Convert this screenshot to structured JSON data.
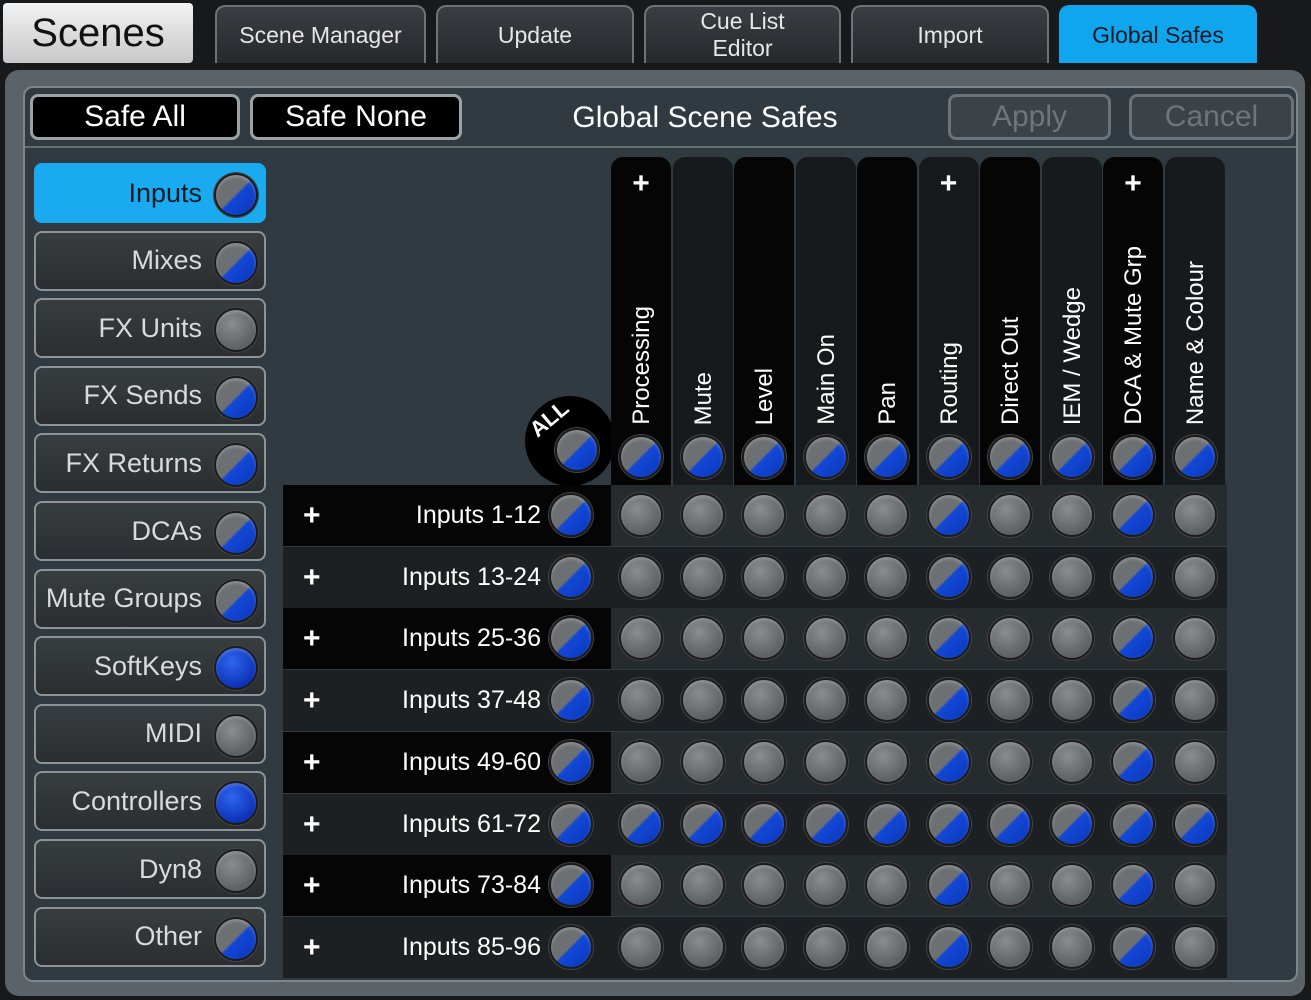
{
  "app_title": "Scenes",
  "tabs": [
    {
      "label": "Scene Manager",
      "active": false
    },
    {
      "label": "Update",
      "active": false
    },
    {
      "label": "Cue List Editor",
      "active": false
    },
    {
      "label": "Import",
      "active": false
    },
    {
      "label": "Global Safes",
      "active": true
    }
  ],
  "header": {
    "safe_all": "Safe All",
    "safe_none": "Safe None",
    "title": "Global Scene Safes",
    "apply": "Apply",
    "cancel": "Cancel"
  },
  "sidebar": [
    {
      "label": "Inputs",
      "state": "half",
      "active": true
    },
    {
      "label": "Mixes",
      "state": "half",
      "active": false
    },
    {
      "label": "FX Units",
      "state": "off",
      "active": false
    },
    {
      "label": "FX Sends",
      "state": "half",
      "active": false
    },
    {
      "label": "FX Returns",
      "state": "half",
      "active": false
    },
    {
      "label": "DCAs",
      "state": "half",
      "active": false
    },
    {
      "label": "Mute Groups",
      "state": "half",
      "active": false
    },
    {
      "label": "SoftKeys",
      "state": "on",
      "active": false
    },
    {
      "label": "MIDI",
      "state": "off",
      "active": false
    },
    {
      "label": "Controllers",
      "state": "on",
      "active": false
    },
    {
      "label": "Dyn8",
      "state": "off",
      "active": false
    },
    {
      "label": "Other",
      "state": "half",
      "active": false
    }
  ],
  "grid": {
    "all_label": "ALL",
    "all_state": "half",
    "columns": [
      {
        "label": "Processing",
        "expandable": true,
        "state": "half"
      },
      {
        "label": "Mute",
        "expandable": false,
        "state": "half"
      },
      {
        "label": "Level",
        "expandable": false,
        "state": "half"
      },
      {
        "label": "Main On",
        "expandable": false,
        "state": "half"
      },
      {
        "label": "Pan",
        "expandable": false,
        "state": "half"
      },
      {
        "label": "Routing",
        "expandable": true,
        "state": "half"
      },
      {
        "label": "Direct Out",
        "expandable": false,
        "state": "half"
      },
      {
        "label": "IEM / Wedge",
        "expandable": false,
        "state": "half"
      },
      {
        "label": "DCA & Mute Grp",
        "expandable": true,
        "state": "half"
      },
      {
        "label": "Name & Colour",
        "expandable": false,
        "state": "half"
      }
    ],
    "rows": [
      {
        "label": "Inputs 1-12",
        "state": "half",
        "cells": [
          "off",
          "off",
          "off",
          "off",
          "off",
          "half",
          "off",
          "off",
          "half",
          "off"
        ]
      },
      {
        "label": "Inputs 13-24",
        "state": "half",
        "cells": [
          "off",
          "off",
          "off",
          "off",
          "off",
          "half",
          "off",
          "off",
          "half",
          "off"
        ]
      },
      {
        "label": "Inputs 25-36",
        "state": "half",
        "cells": [
          "off",
          "off",
          "off",
          "off",
          "off",
          "half",
          "off",
          "off",
          "half",
          "off"
        ]
      },
      {
        "label": "Inputs 37-48",
        "state": "half",
        "cells": [
          "off",
          "off",
          "off",
          "off",
          "off",
          "half",
          "off",
          "off",
          "half",
          "off"
        ]
      },
      {
        "label": "Inputs 49-60",
        "state": "half",
        "cells": [
          "off",
          "off",
          "off",
          "off",
          "off",
          "half",
          "off",
          "off",
          "half",
          "off"
        ]
      },
      {
        "label": "Inputs 61-72",
        "state": "half",
        "cells": [
          "half",
          "half",
          "half",
          "half",
          "half",
          "half",
          "half",
          "half",
          "half",
          "half"
        ]
      },
      {
        "label": "Inputs 73-84",
        "state": "half",
        "cells": [
          "off",
          "off",
          "off",
          "off",
          "off",
          "half",
          "off",
          "off",
          "half",
          "off"
        ]
      },
      {
        "label": "Inputs 85-96",
        "state": "half",
        "cells": [
          "off",
          "off",
          "off",
          "off",
          "off",
          "half",
          "off",
          "off",
          "half",
          "off"
        ]
      }
    ],
    "plus_symbol": "+"
  },
  "colors": {
    "accent": "#0fa6ee",
    "knob_on": "#1248d6",
    "knob_off": "#6d7073"
  }
}
